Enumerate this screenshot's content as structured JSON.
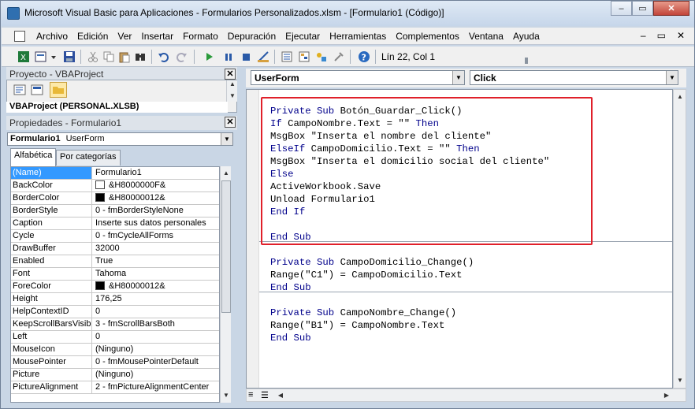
{
  "window": {
    "title": "Microsoft Visual Basic para Aplicaciones - Formularios Personalizados.xlsm - [Formulario1 (Código)]",
    "minimize": "–",
    "restore": "▭",
    "close": "✕"
  },
  "menu": {
    "items": [
      "Archivo",
      "Edición",
      "Ver",
      "Insertar",
      "Formato",
      "Depuración",
      "Ejecutar",
      "Herramientas",
      "Complementos",
      "Ventana",
      "Ayuda"
    ],
    "mdi_min": "–",
    "mdi_restore": "▭",
    "mdi_close": "✕"
  },
  "toolbar": {
    "position": "Lín 22, Col 1"
  },
  "project_panel": {
    "title": "Proyecto - VBAProject",
    "tree_item": "VBAProject (PERSONAL.XLSB)"
  },
  "properties_panel": {
    "title": "Propiedades - Formulario1",
    "object_name": "Formulario1",
    "object_type": "UserForm",
    "tabs": [
      "Alfabética",
      "Por categorías"
    ],
    "rows": [
      {
        "name": "(Name)",
        "value": "Formulario1"
      },
      {
        "name": "BackColor",
        "value": "&H8000000F&",
        "swatch": "#ffffff"
      },
      {
        "name": "BorderColor",
        "value": "&H80000012&",
        "swatch": "#000000"
      },
      {
        "name": "BorderStyle",
        "value": "0 - fmBorderStyleNone"
      },
      {
        "name": "Caption",
        "value": "Inserte sus datos personales"
      },
      {
        "name": "Cycle",
        "value": "0 - fmCycleAllForms"
      },
      {
        "name": "DrawBuffer",
        "value": "32000"
      },
      {
        "name": "Enabled",
        "value": "True"
      },
      {
        "name": "Font",
        "value": "Tahoma"
      },
      {
        "name": "ForeColor",
        "value": "&H80000012&",
        "swatch": "#000000"
      },
      {
        "name": "Height",
        "value": "176,25"
      },
      {
        "name": "HelpContextID",
        "value": "0"
      },
      {
        "name": "KeepScrollBarsVisible",
        "value": "3 - fmScrollBarsBoth"
      },
      {
        "name": "Left",
        "value": "0"
      },
      {
        "name": "MouseIcon",
        "value": "(Ninguno)"
      },
      {
        "name": "MousePointer",
        "value": "0 - fmMousePointerDefault"
      },
      {
        "name": "Picture",
        "value": "(Ninguno)"
      },
      {
        "name": "PictureAlignment",
        "value": "2 - fmPictureAlignmentCenter"
      }
    ]
  },
  "code_window": {
    "object_combo": "UserForm",
    "proc_combo": "Click",
    "lines": [
      [
        {
          "t": "Private Sub ",
          "k": true
        },
        {
          "t": "Botón_Guardar_Click()"
        }
      ],
      [
        {
          "t": "If ",
          "k": true
        },
        {
          "t": "CampoNombre.Text = \"\" "
        },
        {
          "t": "Then",
          "k": true
        }
      ],
      [
        {
          "t": "MsgBox \"Inserta el nombre del cliente\""
        }
      ],
      [
        {
          "t": "ElseIf ",
          "k": true
        },
        {
          "t": "CampoDomicilio.Text = \"\" "
        },
        {
          "t": "Then",
          "k": true
        }
      ],
      [
        {
          "t": "MsgBox \"Inserta el domicilio social del cliente\""
        }
      ],
      [
        {
          "t": "Else",
          "k": true
        }
      ],
      [
        {
          "t": "ActiveWorkbook.Save"
        }
      ],
      [
        {
          "t": "Unload Formulario1"
        }
      ],
      [
        {
          "t": "End If",
          "k": true
        }
      ],
      [],
      [
        {
          "t": "End Sub",
          "k": true
        }
      ],
      [],
      [
        {
          "t": "Private Sub ",
          "k": true
        },
        {
          "t": "CampoDomicilio_Change()"
        }
      ],
      [
        {
          "t": "Range(\"C1\") = CampoDomicilio.Text"
        }
      ],
      [
        {
          "t": "End Sub",
          "k": true
        }
      ],
      [],
      [
        {
          "t": "Private Sub ",
          "k": true
        },
        {
          "t": "CampoNombre_Change()"
        }
      ],
      [
        {
          "t": "Range(\"B1\") = CampoNombre.Text"
        }
      ],
      [
        {
          "t": "End Sub",
          "k": true
        }
      ]
    ]
  },
  "colors": {
    "keyword": "#00008b",
    "highlight": "#e0202a",
    "selection": "#3399ff"
  }
}
